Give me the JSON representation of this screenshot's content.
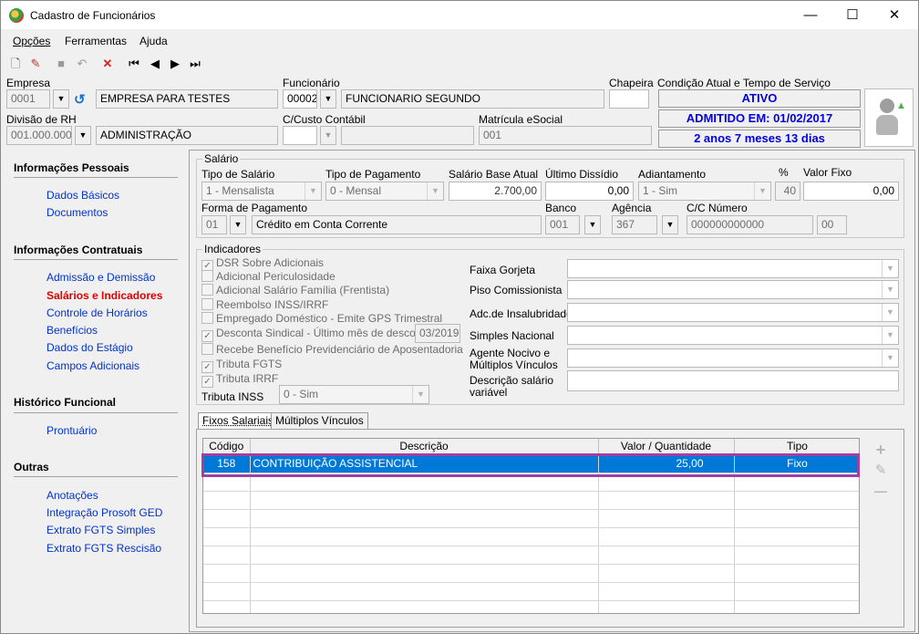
{
  "window": {
    "title": "Cadastro de Funcionários",
    "minimize": "—",
    "maximize": "☐",
    "close": "✕"
  },
  "menu": [
    "Opções",
    "Ferramentas",
    "Ajuda"
  ],
  "toolbar": {
    "new": "🗋",
    "edit": "✎",
    "save": "■",
    "undo": "↶",
    "delete": "✕",
    "first": "⏮",
    "prev": "◀",
    "next": "▶",
    "last": "⏭"
  },
  "header": {
    "empresa_label": "Empresa",
    "empresa_code": "0001",
    "empresa_name": "EMPRESA PARA TESTES",
    "funcionario_label": "Funcionário",
    "funcionario_code": "00002",
    "funcionario_name": "FUNCIONARIO SEGUNDO",
    "chapeira_label": "Chapeira",
    "chapeira_value": "",
    "condicao_label": "Condição Atual e Tempo de Serviço",
    "divisao_label": "Divisão de RH",
    "divisao_code": "001.000.000",
    "divisao_name": "ADMINISTRAÇÃO",
    "custo_label": "C/Custo Contábil",
    "custo_value": "",
    "custo_name": "",
    "matricula_label": "Matrícula eSocial",
    "matricula_value": "001"
  },
  "status": {
    "ativo": "ATIVO",
    "admitido": "ADMITIDO EM: 01/02/2017",
    "tempo": "2 anos 7 meses 13 dias"
  },
  "nav": {
    "pessoais_title": "Informações Pessoais",
    "pessoais_items": [
      "Dados Básicos",
      "Documentos"
    ],
    "contratuais_title": "Informações Contratuais",
    "contratuais_items": [
      "Admissão e Demissão",
      "Salários e Indicadores",
      "Controle de Horários",
      "Benefícios",
      "Dados do Estágio",
      "Campos Adicionais"
    ],
    "historico_title": "Histórico Funcional",
    "historico_items": [
      "Prontuário"
    ],
    "outras_title": "Outras",
    "outras_items": [
      "Anotações",
      "Integração Prosoft GED",
      "Extrato FGTS Simples",
      "Extrato FGTS Rescisão"
    ]
  },
  "salario": {
    "group_title": "Salário",
    "tipo_label": "Tipo de Salário",
    "tipo_value": "1 - Mensalista",
    "tipo_pag_label": "Tipo de Pagamento",
    "tipo_pag_value": "0 - Mensal",
    "base_label": "Salário Base Atual",
    "base_value": "2.700,00",
    "dissidio_label": "Último Dissídio",
    "dissidio_value": "0,00",
    "adiant_label": "Adiantamento",
    "adiant_value": "1 - Sim",
    "pct_label": "%",
    "pct_value": "40",
    "vfixo_label": "Valor Fixo",
    "vfixo_value": "0,00",
    "forma_label": "Forma de Pagamento",
    "forma_code": "01",
    "forma_name": "Crédito em Conta Corrente",
    "banco_label": "Banco",
    "banco_value": "001",
    "agencia_label": "Agência",
    "agencia_value": "367",
    "cc_label": "C/C Número",
    "cc_value": "000000000000",
    "cc_dv": "00"
  },
  "indicadores": {
    "group_title": "Indicadores",
    "checks": [
      {
        "label": "DSR Sobre Adicionais",
        "checked": "✓"
      },
      {
        "label": "Adicional Periculosidade",
        "checked": ""
      },
      {
        "label": "Adicional Salário Família (Frentista)",
        "checked": ""
      },
      {
        "label": "Reembolso INSS/IRRF",
        "checked": ""
      },
      {
        "label": "Empregado Doméstico - Emite GPS Trimestral",
        "checked": ""
      },
      {
        "label": "Desconta Sindical - Último mês de desconto",
        "checked": "✓"
      },
      {
        "label": "Recebe Benefício Previdenciário de Aposentadoria",
        "checked": ""
      },
      {
        "label": "Tributa FGTS",
        "checked": "✓"
      },
      {
        "label": "Tributa IRRF",
        "checked": "✓"
      }
    ],
    "sindical_month": "03/2019",
    "inss_label": "Tributa INSS",
    "inss_value": "0 - Sim",
    "faixa_label": "Faixa Gorjeta",
    "piso_label": "Piso Comissionista",
    "insal_label": "Adc.de Insalubridade",
    "simples_label": "Simples Nacional",
    "agente_label_1": "Agente Nocivo e",
    "agente_label_2": "Múltiplos Vínculos",
    "desc_label_1": "Descrição salário",
    "desc_label_2": "variável"
  },
  "tabs": [
    "Fixos Salariais",
    "Múltiplos Vínculos"
  ],
  "grid": {
    "headers": [
      "Código",
      "Descrição",
      "Valor / Quantidade",
      "Tipo"
    ],
    "rows": [
      {
        "codigo": "158",
        "descricao": "CONTRIBUIÇÃO ASSISTENCIAL",
        "valor": "25,00",
        "tipo": "Fixo"
      }
    ]
  },
  "grid_buttons": {
    "add": "+",
    "edit": "✎",
    "remove": "—"
  }
}
